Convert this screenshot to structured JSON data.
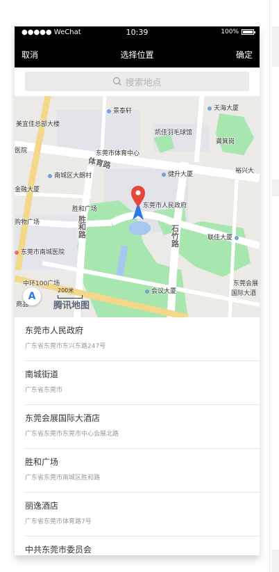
{
  "status_bar": {
    "carrier": "●●●●● WeChat",
    "time": "10:39",
    "battery": "100%"
  },
  "nav": {
    "cancel": "取消",
    "title": "选择位置",
    "confirm": "确定"
  },
  "search": {
    "placeholder": "搜索地点"
  },
  "map": {
    "brand": "腾讯地图",
    "scale": "200米",
    "center_label": "东莞市人民政府",
    "labels": {
      "jingyuxuan": "景泰轩",
      "tianhai": "天海大厦",
      "meiyi": "美宜佳总部大楼",
      "kaijia": "凯佳羽毛球馆",
      "gongji": "龚箕岗",
      "yiyuan": "医院",
      "tiyu_center": "东莞市体育中心",
      "nancheng_bldg": "南城区大朗村",
      "jiansheng": "健升大厦",
      "yuxing": "裕兴大",
      "jinrong": "金融大厦",
      "shenghe_square": "胜和广场",
      "shopping": "购物广场",
      "nancheng_hosp": "东莞市南城医院",
      "lianjia": "联佳大厦",
      "zhonghuan": "中环100广场",
      "shangpin": "商品",
      "huiyi": "会议大厦",
      "dongguan_hui": "东莞会展",
      "guoji": "国际大酒",
      "road_tiyu": "体育路",
      "road_shenghe": "胜和路",
      "road_shizhu": "石竹路"
    }
  },
  "results": [
    {
      "name": "东莞市人民政府",
      "address": "广东省东莞市东兴东路247号"
    },
    {
      "name": "南城街道",
      "address": "广东省东莞市"
    },
    {
      "name": "东莞会展国际大酒店",
      "address": "广东省东莞市东莞市中心会展北路"
    },
    {
      "name": "胜和广场",
      "address": "广东省东莞市南城区胜和路"
    },
    {
      "name": "丽逸酒店",
      "address": "广东省东莞市体育路7号"
    },
    {
      "name": "中共东莞市委员会",
      "address": ""
    }
  ],
  "colors": {
    "nav_bg": "#000000",
    "park_green": "#a8e6b0",
    "water_blue": "#a6c8ee",
    "road_yellow": "#f5d78a",
    "pin_red": "#e8453c",
    "pin_blue": "#2d79e8"
  }
}
